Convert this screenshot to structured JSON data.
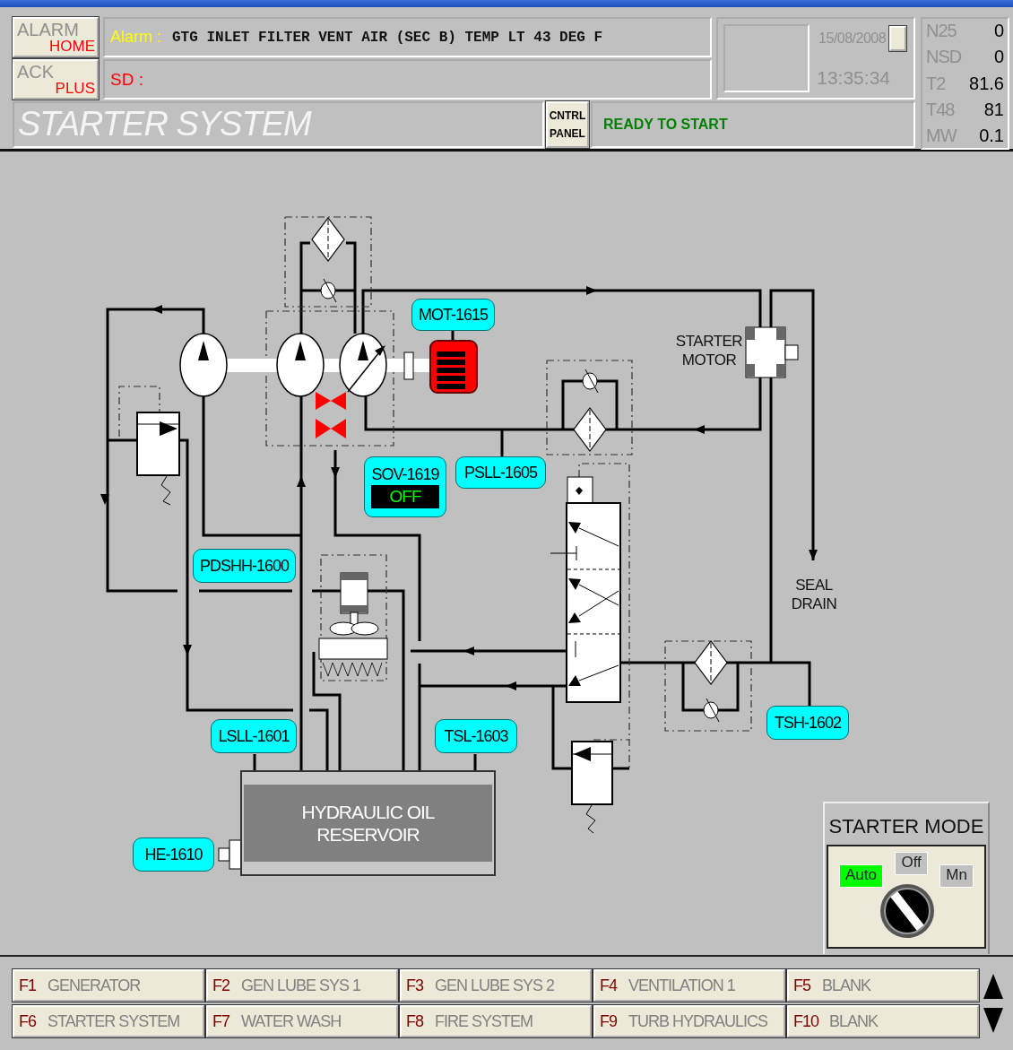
{
  "alarm_buttons": [
    {
      "top": "ALARM",
      "bottom": "HOME"
    },
    {
      "top": "ACK",
      "bottom": "PLUS"
    }
  ],
  "alarm": {
    "label": "Alarm :",
    "text": "GTG INLET FILTER VENT AIR (SEC B) TEMP LT 43 DEG F"
  },
  "shutdown": {
    "label": "SD :"
  },
  "clock": {
    "date": "15/08/2008",
    "time": "13:35:34"
  },
  "readouts": [
    {
      "name": "N25",
      "value": "0"
    },
    {
      "name": "NSD",
      "value": "0"
    },
    {
      "name": "T2",
      "value": "81.6"
    },
    {
      "name": "T48",
      "value": "81"
    },
    {
      "name": "MW",
      "value": "0.1"
    }
  ],
  "screen_title": "STARTER SYSTEM",
  "control_panel_button": "CNTRL PANEL",
  "status": "READY TO START",
  "diagram": {
    "tags": [
      {
        "text": "MOT-1615"
      },
      {
        "text": "SOV-1619",
        "state": "OFF"
      },
      {
        "text": "PSLL-1605"
      },
      {
        "text": "PDSHH-1600"
      },
      {
        "text": "LSLL-1601"
      },
      {
        "text": "TSL-1603"
      },
      {
        "text": "TSH-1602"
      },
      {
        "text": "HE-1610"
      }
    ],
    "labels": [
      "STARTER MOTOR",
      "SEAL DRAIN"
    ],
    "reservoir": "HYDRAULIC OIL RESERVOIR"
  },
  "starter_mode": {
    "title": "STARTER MODE",
    "positions": [
      {
        "label": "Auto",
        "selected": true
      },
      {
        "label": "Off",
        "selected": false
      },
      {
        "label": "Mn",
        "selected": false
      }
    ]
  },
  "function_keys": [
    {
      "key": "F1",
      "label": "GENERATOR"
    },
    {
      "key": "F2",
      "label": "GEN LUBE SYS 1"
    },
    {
      "key": "F3",
      "label": "GEN LUBE SYS 2"
    },
    {
      "key": "F4",
      "label": "VENTILATION 1"
    },
    {
      "key": "F5",
      "label": "BLANK"
    },
    {
      "key": "F6",
      "label": "STARTER SYSTEM"
    },
    {
      "key": "F7",
      "label": "WATER WASH"
    },
    {
      "key": "F8",
      "label": "FIRE SYSTEM"
    },
    {
      "key": "F9",
      "label": "TURB HYDRAULICS"
    },
    {
      "key": "F10",
      "label": "BLANK"
    }
  ]
}
